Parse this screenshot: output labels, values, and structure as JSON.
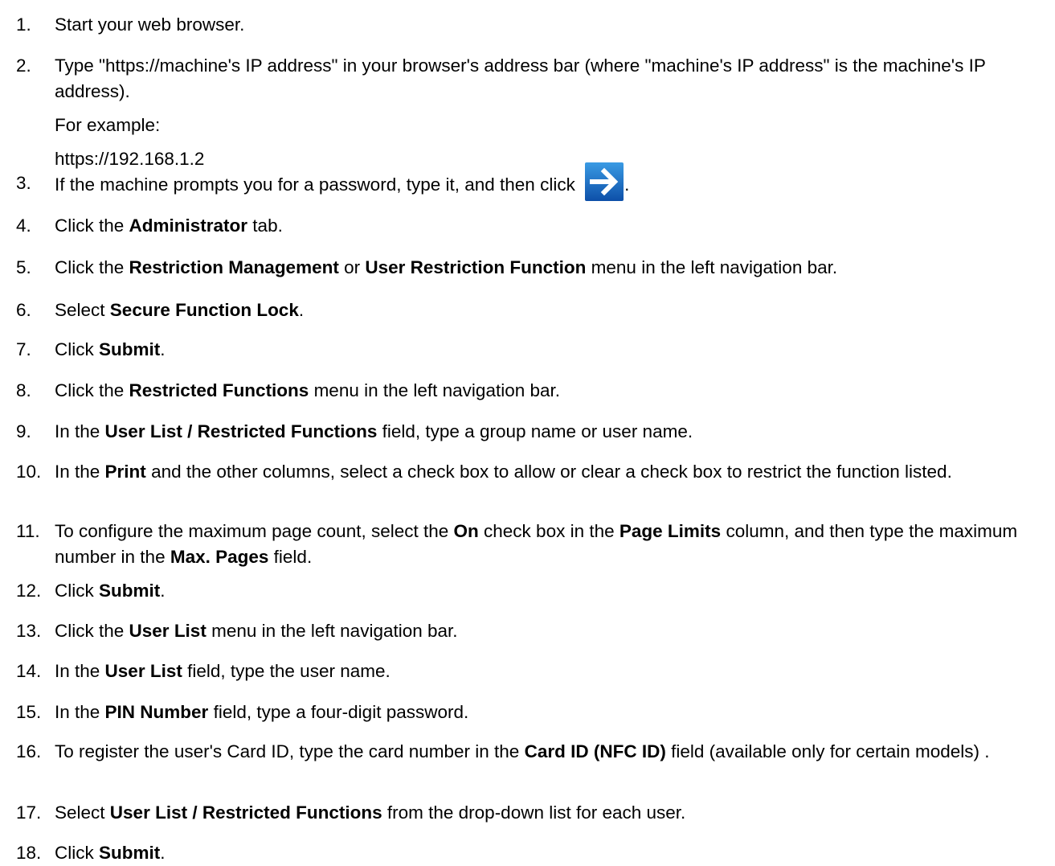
{
  "steps": [
    {
      "num": "1.",
      "parts": [
        {
          "t": "Start your web browser."
        }
      ]
    },
    {
      "num": "2.",
      "parts": [
        {
          "t": "Type \"https://machine's IP address\" in your browser's address bar (where \"machine's IP address\" is the machine's IP address)."
        }
      ],
      "sub": [
        "For example:",
        "https://192.168.1.2"
      ]
    },
    {
      "num": "3.",
      "parts": [
        {
          "t": "If the machine prompts you for a password, type it, and then click "
        },
        {
          "icon": "arrow-right-icon"
        },
        {
          "t": "."
        }
      ]
    },
    {
      "num": "4.",
      "parts": [
        {
          "t": "Click the "
        },
        {
          "b": "Administrator"
        },
        {
          "t": " tab."
        }
      ]
    },
    {
      "num": "5.",
      "parts": [
        {
          "t": "Click the "
        },
        {
          "b": "Restriction Management"
        },
        {
          "t": " or "
        },
        {
          "b": "User Restriction Function"
        },
        {
          "t": " menu in the left navigation bar."
        }
      ]
    },
    {
      "num": "6.",
      "parts": [
        {
          "t": "Select "
        },
        {
          "b": "Secure Function Lock"
        },
        {
          "t": "."
        }
      ]
    },
    {
      "num": "7.",
      "parts": [
        {
          "t": "Click "
        },
        {
          "b": "Submit"
        },
        {
          "t": "."
        }
      ]
    },
    {
      "num": "8.",
      "parts": [
        {
          "t": "Click the "
        },
        {
          "b": "Restricted Functions"
        },
        {
          "t": " menu in the left navigation bar."
        }
      ]
    },
    {
      "num": "9.",
      "parts": [
        {
          "t": "In the "
        },
        {
          "b": "User List / Restricted Functions"
        },
        {
          "t": " field, type a group name or user name."
        }
      ]
    },
    {
      "num": "10.",
      "parts": [
        {
          "t": "In the "
        },
        {
          "b": "Print"
        },
        {
          "t": " and the other columns, select a check box to allow or clear a check box to restrict the function listed."
        }
      ]
    },
    {
      "num": "11.",
      "parts": [
        {
          "t": "To configure the maximum page count, select the "
        },
        {
          "b": "On"
        },
        {
          "t": " check box in the "
        },
        {
          "b": "Page Limits"
        },
        {
          "t": " column, and then type the maximum number in the "
        },
        {
          "b": "Max. Pages"
        },
        {
          "t": " field."
        }
      ]
    },
    {
      "num": "12.",
      "parts": [
        {
          "t": "Click "
        },
        {
          "b": "Submit"
        },
        {
          "t": "."
        }
      ]
    },
    {
      "num": "13.",
      "parts": [
        {
          "t": "Click the "
        },
        {
          "b": "User List"
        },
        {
          "t": " menu in the left navigation bar."
        }
      ]
    },
    {
      "num": "14.",
      "parts": [
        {
          "t": "In the "
        },
        {
          "b": "User List"
        },
        {
          "t": " field, type the user name."
        }
      ]
    },
    {
      "num": "15.",
      "parts": [
        {
          "t": "In the "
        },
        {
          "b": "PIN Number"
        },
        {
          "t": " field, type a four-digit password."
        }
      ]
    },
    {
      "num": "16.",
      "parts": [
        {
          "t": "To register the user's Card ID, type the card number in the "
        },
        {
          "b": "Card ID (NFC ID)"
        },
        {
          "t": " field (available only for certain models) ."
        }
      ]
    },
    {
      "num": "17.",
      "parts": [
        {
          "t": "Select "
        },
        {
          "b": "User List / Restricted Functions"
        },
        {
          "t": " from the drop-down list for each user."
        }
      ]
    },
    {
      "num": "18.",
      "parts": [
        {
          "t": "Click "
        },
        {
          "b": "Submit"
        },
        {
          "t": "."
        }
      ]
    }
  ],
  "colors": {
    "arrow_button_top": "#3a9be4",
    "arrow_button_bottom": "#0d4fa8",
    "arrow_glyph": "#ffffff"
  }
}
